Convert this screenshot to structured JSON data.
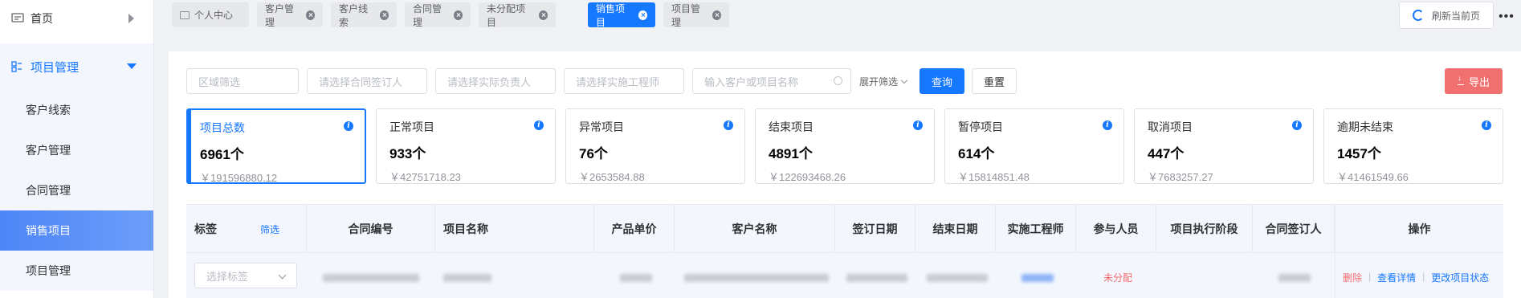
{
  "sidebar": {
    "home": "首页",
    "group": "项目管理",
    "items": [
      "客户线索",
      "客户管理",
      "合同管理",
      "销售项目",
      "项目管理"
    ],
    "active_index": 3
  },
  "tabs": {
    "items": [
      "个人中心",
      "客户管理",
      "客户线索",
      "合同管理",
      "未分配项目",
      "销售项目",
      "项目管理"
    ],
    "active": "销售项目",
    "refresh": "刷新当前页",
    "more": "•••"
  },
  "filters": {
    "region": "区域筛选",
    "signer": "请选择合同签订人",
    "owner": "请选择实际负责人",
    "engineer": "请选择实施工程师",
    "search": "输入客户或项目名称",
    "expand": "展开筛选",
    "query": "查询",
    "reset": "重置",
    "export": "导出"
  },
  "stats": [
    {
      "title": "项目总数",
      "count": "6961个",
      "amount": "￥191596880.12"
    },
    {
      "title": "正常项目",
      "count": "933个",
      "amount": "￥42751718.23"
    },
    {
      "title": "异常项目",
      "count": "76个",
      "amount": "￥2653584.88"
    },
    {
      "title": "结束项目",
      "count": "4891个",
      "amount": "￥122693468.26"
    },
    {
      "title": "暂停项目",
      "count": "614个",
      "amount": "￥15814851.48"
    },
    {
      "title": "取消项目",
      "count": "447个",
      "amount": "￥7683257.27"
    },
    {
      "title": "逾期未结束",
      "count": "1457个",
      "amount": "￥41461549.66"
    }
  ],
  "table": {
    "columns": [
      "标签",
      "合同编号",
      "项目名称",
      "产品单价",
      "客户名称",
      "签订日期",
      "结束日期",
      "实施工程师",
      "参与人员",
      "项目执行阶段",
      "合同签订人",
      "操作"
    ],
    "tag_filter": "筛选",
    "row": {
      "tag_placeholder": "选择标签",
      "participants": "未分配",
      "ops": [
        "删除",
        "查看详情",
        "更改项目状态"
      ]
    }
  },
  "colors": {
    "accent": "#1677ff",
    "danger": "#f56c6c",
    "export": "#f07070"
  }
}
